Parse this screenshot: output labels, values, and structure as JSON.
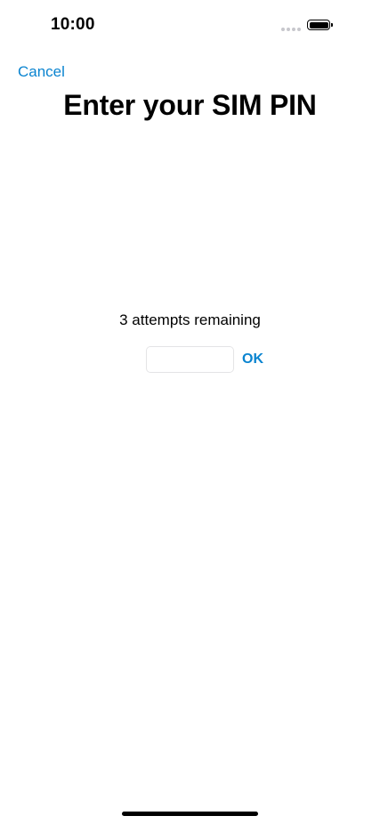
{
  "status_bar": {
    "time": "10:00",
    "signal_icon": "cellular-signal-dots-icon",
    "battery_icon": "battery-full-icon",
    "battery_level": 1.0
  },
  "nav": {
    "cancel_label": "Cancel"
  },
  "header": {
    "title": "Enter your SIM PIN"
  },
  "pin_form": {
    "attempts_text": "3 attempts remaining",
    "pin_value": "",
    "ok_label": "OK"
  },
  "colors": {
    "accent": "#0a84d0",
    "text": "#000000",
    "background": "#ffffff"
  }
}
